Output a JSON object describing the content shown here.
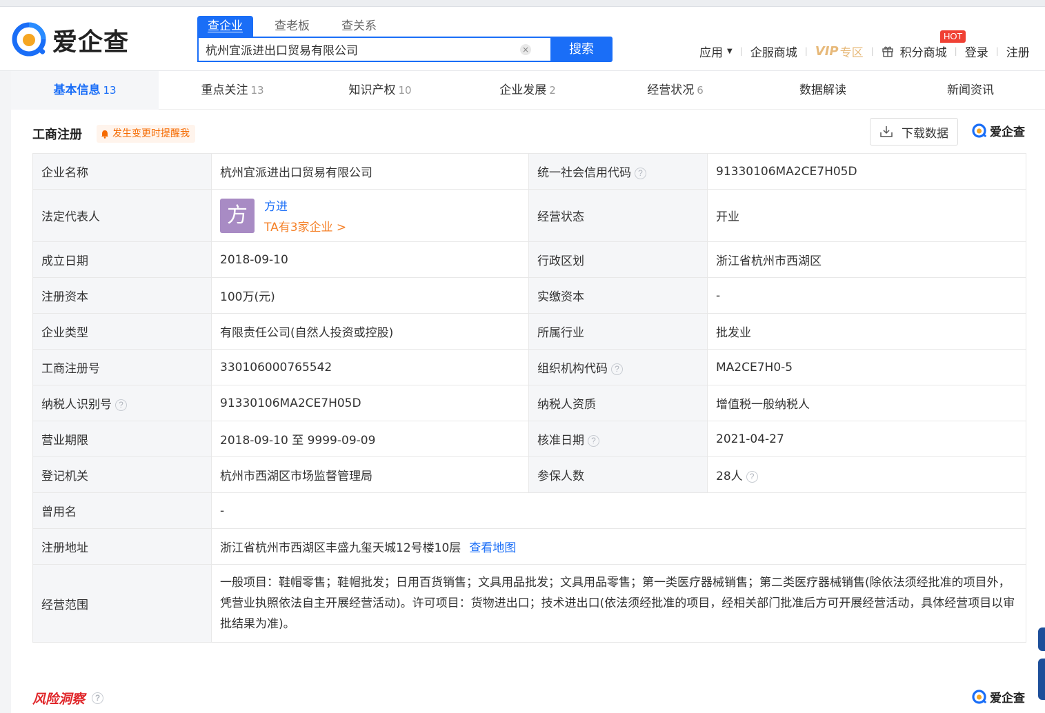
{
  "brand": {
    "name": "爱企查"
  },
  "search": {
    "tabs": [
      "查企业",
      "查老板",
      "查关系"
    ],
    "value": "杭州宜派进出口贸易有限公司",
    "clear": "×",
    "button": "搜索"
  },
  "nav": {
    "apps": "应用",
    "mall": "企服商城",
    "vip": "VIP",
    "vip_zone": "专区",
    "hot": "HOT",
    "points": "积分商城",
    "login": "登录",
    "register": "注册"
  },
  "tabs": [
    {
      "label": "基本信息",
      "count": "13"
    },
    {
      "label": "重点关注",
      "count": "13"
    },
    {
      "label": "知识产权",
      "count": "10"
    },
    {
      "label": "企业发展",
      "count": "2"
    },
    {
      "label": "经营状况",
      "count": "6"
    },
    {
      "label": "数据解读",
      "count": ""
    },
    {
      "label": "新闻资讯",
      "count": ""
    }
  ],
  "section": {
    "title": "工商注册",
    "remind": "发生变更时提醒我",
    "download": "下载数据",
    "help": "?"
  },
  "info": {
    "company_name_label": "企业名称",
    "company_name": "杭州宜派进出口贸易有限公司",
    "credit_code_label": "统一社会信用代码",
    "credit_code": "91330106MA2CE7H05D",
    "legal_rep_label": "法定代表人",
    "legal_rep_avatar": "方",
    "legal_rep_name": "方进",
    "legal_rep_more": "TA有3家企业 >",
    "status_label": "经营状态",
    "status": "开业",
    "founded_label": "成立日期",
    "founded": "2018-09-10",
    "region_label": "行政区划",
    "region": "浙江省杭州市西湖区",
    "reg_capital_label": "注册资本",
    "reg_capital": "100万(元)",
    "paid_capital_label": "实缴资本",
    "paid_capital": "-",
    "type_label": "企业类型",
    "type": "有限责任公司(自然人投资或控股)",
    "industry_label": "所属行业",
    "industry": "批发业",
    "reg_no_label": "工商注册号",
    "reg_no": "330106000765542",
    "org_code_label": "组织机构代码",
    "org_code": "MA2CE7H0-5",
    "taxpayer_id_label": "纳税人识别号",
    "taxpayer_id": "91330106MA2CE7H05D",
    "taxpayer_qual_label": "纳税人资质",
    "taxpayer_qual": "增值税一般纳税人",
    "term_label": "营业期限",
    "term": "2018-09-10 至 9999-09-09",
    "approved_label": "核准日期",
    "approved": "2021-04-27",
    "authority_label": "登记机关",
    "authority": "杭州市西湖区市场监督管理局",
    "insured_label": "参保人数",
    "insured": "28人",
    "former_name_label": "曾用名",
    "former_name": "-",
    "address_label": "注册地址",
    "address": "浙江省杭州市西湖区丰盛九玺天城12号楼10层",
    "map_link": "查看地图",
    "scope_label": "经营范围",
    "scope": "一般项目：鞋帽零售；鞋帽批发；日用百货销售；文具用品批发；文具用品零售；第一类医疗器械销售；第二类医疗器械销售(除依法须经批准的项目外，凭营业执照依法自主开展经营活动)。许可项目：货物进出口；技术进出口(依法须经批准的项目，经相关部门批准后方可开展经营活动，具体经营项目以审批结果为准)。"
  },
  "risk": {
    "title": "风险洞察"
  },
  "colors": {
    "primary": "#1a6ef7",
    "accent_orange": "#f5822a",
    "risk_red": "#e0262a",
    "avatar_bg": "#a88bc4"
  }
}
